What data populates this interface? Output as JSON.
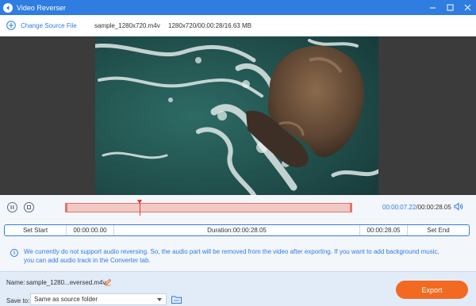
{
  "window": {
    "title": "Video Reverser",
    "controls": [
      "minimize-icon",
      "maximize-icon",
      "close-icon"
    ]
  },
  "toolbar": {
    "change_source_label": "Change Source File",
    "file_name": "sample_1280x720.m4v",
    "file_info": "1280x720/00:00:28/16.63 MB"
  },
  "player": {
    "current_time": "00:00:07.22",
    "separator": "/",
    "total_time": "00:00:28.05",
    "progress_fraction": 0.257
  },
  "range": {
    "set_start_label": "Set Start",
    "start_time": "00:00:00.00",
    "duration_text": "Duration:00:00:28.05",
    "end_time": "00:00:28.05",
    "set_end_label": "Set End"
  },
  "notice": "We currently do not support audio reversing. So, the audio part will be removed from the video after exporting. If you want to add background music, you can add audio track in the Converter tab.",
  "output": {
    "name_label": "Name:",
    "name_value": "sample_1280...eversed.m4v",
    "save_label": "Save to:",
    "save_value": "Same as source folder",
    "export_label": "Export"
  },
  "colors": {
    "accent": "#2f7de1",
    "export": "#f26a21",
    "trim_fill": "#f1c9c4",
    "trim_border": "#e0766b",
    "playhead": "#e53935"
  }
}
